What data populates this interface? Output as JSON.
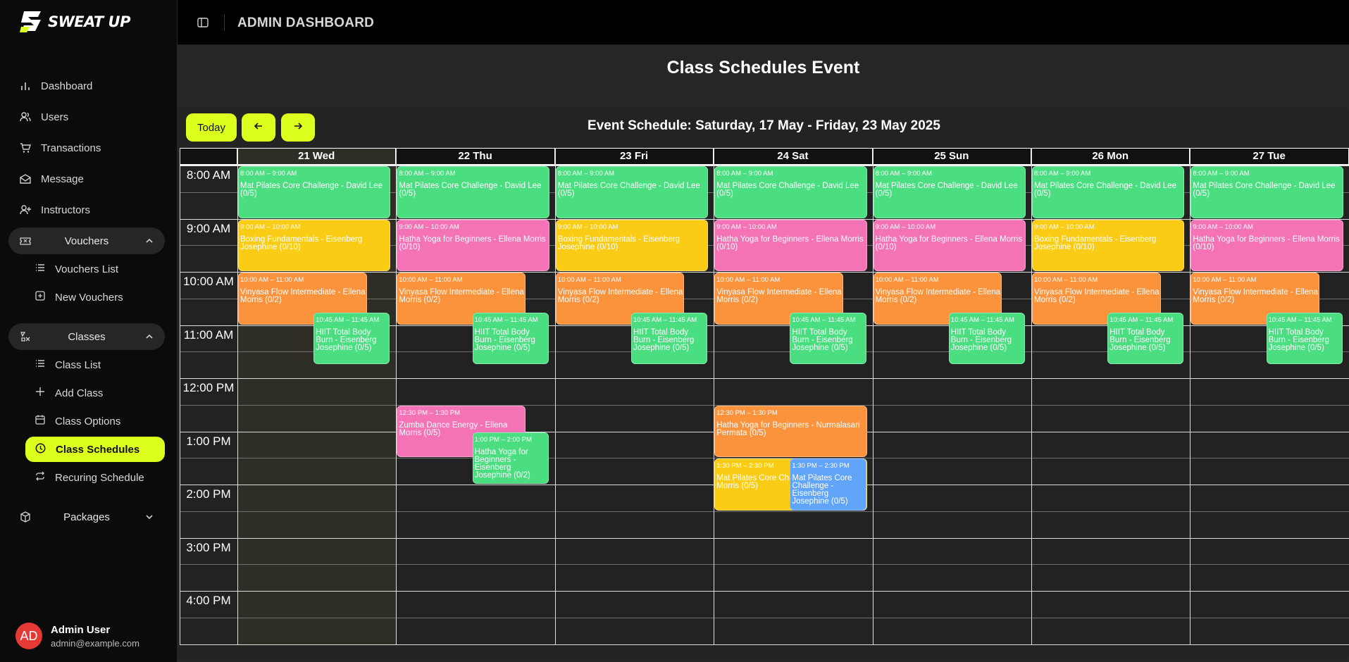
{
  "brand": {
    "name": "SWEAT UP"
  },
  "sidebar": {
    "items": [
      {
        "label": "Dashboard",
        "icon": "bar-chart-icon"
      },
      {
        "label": "Users",
        "icon": "users-icon"
      },
      {
        "label": "Transactions",
        "icon": "cart-icon"
      },
      {
        "label": "Message",
        "icon": "mail-icon"
      },
      {
        "label": "Instructors",
        "icon": "user-plus-icon"
      }
    ],
    "vouchers": {
      "label": "Vouchers",
      "items": [
        {
          "label": "Vouchers List"
        },
        {
          "label": "New Vouchers"
        }
      ]
    },
    "classes": {
      "label": "Classes",
      "items": [
        {
          "label": "Class List"
        },
        {
          "label": "Add Class"
        },
        {
          "label": "Class Options"
        },
        {
          "label": "Class Schedules",
          "active": true
        },
        {
          "label": "Recuring Schedule"
        }
      ]
    },
    "packages": {
      "label": "Packages"
    }
  },
  "user": {
    "initials": "AD",
    "name": "Admin User",
    "email": "admin@example.com"
  },
  "topbar": {
    "title": "ADMIN DASHBOARD"
  },
  "page": {
    "title": "Class Schedules Event"
  },
  "toolbar": {
    "today_label": "Today",
    "prev_icon": "arrow-left-icon",
    "next_icon": "arrow-right-icon"
  },
  "schedule": {
    "title": "Event Schedule: Saturday, 17 May - Friday, 23 May 2025",
    "days": [
      "21 Wed",
      "22 Thu",
      "23 Fri",
      "24 Sat",
      "25 Sun",
      "26 Mon",
      "27 Tue"
    ],
    "today_index": 0,
    "times": [
      "8:00 AM",
      "9:00 AM",
      "10:00 AM",
      "11:00 AM",
      "12:00 PM",
      "1:00 PM",
      "2:00 PM",
      "3:00 PM",
      "4:00 PM"
    ],
    "colors": {
      "green": "#4ade80",
      "yellow": "#facc15",
      "pink": "#f472b6",
      "orange": "#fb923c",
      "blue": "#60a5fa",
      "accent": "#dcff1e"
    },
    "events": [
      {
        "day": 0,
        "start": 8,
        "end": 9,
        "time": "8:00 AM – 9:00 AM",
        "title": "Mat Pilates Core Challenge - David Lee (0/5)",
        "color": "green",
        "col": "full"
      },
      {
        "day": 0,
        "start": 9,
        "end": 10,
        "time": "9:00 AM – 10:00 AM",
        "title": "Boxing Fundamentals - Eisenberg Josephine (0/10)",
        "color": "yellow",
        "col": "full"
      },
      {
        "day": 0,
        "start": 10,
        "end": 11,
        "time": "10:00 AM – 11:00 AM",
        "title": "Vinyasa Flow Intermediate - Ellena Morris (0/2)",
        "color": "orange",
        "col": "left"
      },
      {
        "day": 0,
        "start": 10.75,
        "end": 11.75,
        "time": "10:45 AM – 11:45 AM",
        "title": "HIIT Total Body Burn - Eisenberg Josephine (0/5)",
        "color": "green",
        "col": "right"
      },
      {
        "day": 1,
        "start": 8,
        "end": 9,
        "time": "8:00 AM – 9:00 AM",
        "title": "Mat Pilates Core Challenge - David Lee (0/5)",
        "color": "green",
        "col": "full"
      },
      {
        "day": 1,
        "start": 9,
        "end": 10,
        "time": "9:00 AM – 10:00 AM",
        "title": "Hatha Yoga for Beginners - Ellena Morris (0/10)",
        "color": "pink",
        "col": "full"
      },
      {
        "day": 1,
        "start": 10,
        "end": 11,
        "time": "10:00 AM – 11:00 AM",
        "title": "Vinyasa Flow Intermediate - Ellena Morris (0/2)",
        "color": "orange",
        "col": "left"
      },
      {
        "day": 1,
        "start": 10.75,
        "end": 11.75,
        "time": "10:45 AM – 11:45 AM",
        "title": "HIIT Total Body Burn - Eisenberg Josephine (0/5)",
        "color": "green",
        "col": "right"
      },
      {
        "day": 1,
        "start": 12.5,
        "end": 13.5,
        "time": "12:30 PM – 1:30 PM",
        "title": "Zumba Dance Energy - Ellena Morris (0/5)",
        "color": "pink",
        "col": "left"
      },
      {
        "day": 1,
        "start": 13,
        "end": 14,
        "time": "1:00 PM – 2:00 PM",
        "title": "Hatha Yoga for Beginners - Eisenberg Josephine (0/2)",
        "color": "green",
        "col": "right"
      },
      {
        "day": 2,
        "start": 8,
        "end": 9,
        "time": "8:00 AM – 9:00 AM",
        "title": "Mat Pilates Core Challenge - David Lee (0/5)",
        "color": "green",
        "col": "full"
      },
      {
        "day": 2,
        "start": 9,
        "end": 10,
        "time": "9:00 AM – 10:00 AM",
        "title": "Boxing Fundamentals - Eisenberg Josephine (0/10)",
        "color": "yellow",
        "col": "full"
      },
      {
        "day": 2,
        "start": 10,
        "end": 11,
        "time": "10:00 AM – 11:00 AM",
        "title": "Vinyasa Flow Intermediate - Ellena Morris (0/2)",
        "color": "orange",
        "col": "left"
      },
      {
        "day": 2,
        "start": 10.75,
        "end": 11.75,
        "time": "10:45 AM – 11:45 AM",
        "title": "HIIT Total Body Burn - Eisenberg Josephine (0/5)",
        "color": "green",
        "col": "right"
      },
      {
        "day": 3,
        "start": 8,
        "end": 9,
        "time": "8:00 AM – 9:00 AM",
        "title": "Mat Pilates Core Challenge - David Lee (0/5)",
        "color": "green",
        "col": "full"
      },
      {
        "day": 3,
        "start": 9,
        "end": 10,
        "time": "9:00 AM – 10:00 AM",
        "title": "Hatha Yoga for Beginners - Ellena Morris (0/10)",
        "color": "pink",
        "col": "full"
      },
      {
        "day": 3,
        "start": 10,
        "end": 11,
        "time": "10:00 AM – 11:00 AM",
        "title": "Vinyasa Flow Intermediate - Ellena Morris (0/2)",
        "color": "orange",
        "col": "left"
      },
      {
        "day": 3,
        "start": 10.75,
        "end": 11.75,
        "time": "10:45 AM – 11:45 AM",
        "title": "HIIT Total Body Burn - Eisenberg Josephine (0/5)",
        "color": "green",
        "col": "right"
      },
      {
        "day": 3,
        "start": 12.5,
        "end": 13.5,
        "time": "12:30 PM – 1:30 PM",
        "title": "Hatha Yoga for Beginners - Nurmalasari Permata (0/5)",
        "color": "orange",
        "col": "full"
      },
      {
        "day": 3,
        "start": 13.5,
        "end": 14.5,
        "time": "1:30 PM – 2:30 PM",
        "title": "Mat Pilates Core Challenge - Ellena Morris (0/5)",
        "color": "yellow",
        "col": "full"
      },
      {
        "day": 3,
        "start": 13.5,
        "end": 14.5,
        "time": "1:30 PM – 2:30 PM",
        "title": "Mat Pilates Core Challenge - Eisenberg Josephine (0/5)",
        "color": "blue",
        "col": "right"
      },
      {
        "day": 4,
        "start": 8,
        "end": 9,
        "time": "8:00 AM – 9:00 AM",
        "title": "Mat Pilates Core Challenge - David Lee (0/5)",
        "color": "green",
        "col": "full"
      },
      {
        "day": 4,
        "start": 9,
        "end": 10,
        "time": "9:00 AM – 10:00 AM",
        "title": "Hatha Yoga for Beginners - Ellena Morris (0/10)",
        "color": "pink",
        "col": "full"
      },
      {
        "day": 4,
        "start": 10,
        "end": 11,
        "time": "10:00 AM – 11:00 AM",
        "title": "Vinyasa Flow Intermediate - Ellena Morris (0/2)",
        "color": "orange",
        "col": "left"
      },
      {
        "day": 4,
        "start": 10.75,
        "end": 11.75,
        "time": "10:45 AM – 11:45 AM",
        "title": "HIIT Total Body Burn - Eisenberg Josephine (0/5)",
        "color": "green",
        "col": "right"
      },
      {
        "day": 5,
        "start": 8,
        "end": 9,
        "time": "8:00 AM – 9:00 AM",
        "title": "Mat Pilates Core Challenge - David Lee (0/5)",
        "color": "green",
        "col": "full"
      },
      {
        "day": 5,
        "start": 9,
        "end": 10,
        "time": "9:00 AM – 10:00 AM",
        "title": "Boxing Fundamentals - Eisenberg Josephine (0/10)",
        "color": "yellow",
        "col": "full"
      },
      {
        "day": 5,
        "start": 10,
        "end": 11,
        "time": "10:00 AM – 11:00 AM",
        "title": "Vinyasa Flow Intermediate - Ellena Morris (0/2)",
        "color": "orange",
        "col": "left"
      },
      {
        "day": 5,
        "start": 10.75,
        "end": 11.75,
        "time": "10:45 AM – 11:45 AM",
        "title": "HIIT Total Body Burn - Eisenberg Josephine (0/5)",
        "color": "green",
        "col": "right"
      },
      {
        "day": 6,
        "start": 8,
        "end": 9,
        "time": "8:00 AM – 9:00 AM",
        "title": "Mat Pilates Core Challenge - David Lee (0/5)",
        "color": "green",
        "col": "full"
      },
      {
        "day": 6,
        "start": 9,
        "end": 10,
        "time": "9:00 AM – 10:00 AM",
        "title": "Hatha Yoga for Beginners - Ellena Morris (0/10)",
        "color": "pink",
        "col": "full"
      },
      {
        "day": 6,
        "start": 10,
        "end": 11,
        "time": "10:00 AM – 11:00 AM",
        "title": "Vinyasa Flow Intermediate - Ellena Morris (0/2)",
        "color": "orange",
        "col": "left"
      },
      {
        "day": 6,
        "start": 10.75,
        "end": 11.75,
        "time": "10:45 AM – 11:45 AM",
        "title": "HIIT Total Body Burn - Eisenberg Josephine (0/5)",
        "color": "green",
        "col": "right"
      }
    ]
  }
}
